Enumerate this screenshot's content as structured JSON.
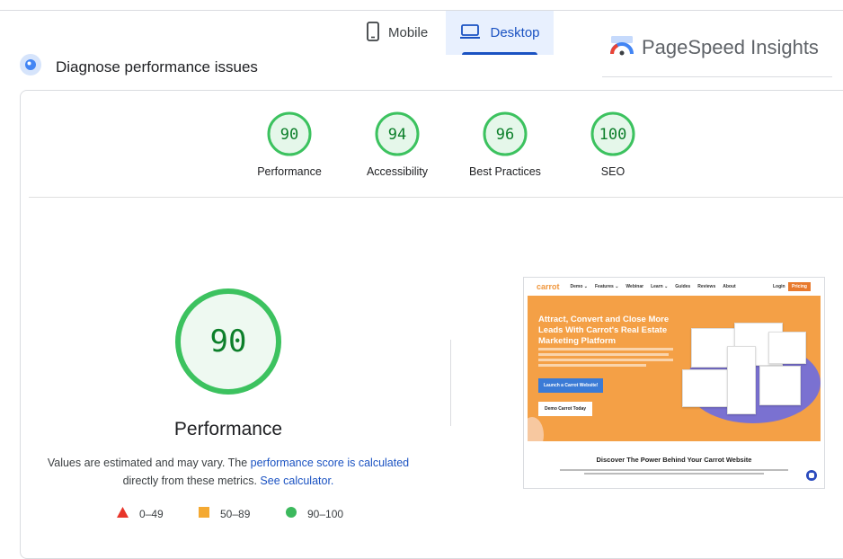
{
  "tabs": {
    "mobile": {
      "label": "Mobile",
      "icon": "mobile-phone-icon"
    },
    "desktop": {
      "label": "Desktop",
      "icon": "laptop-icon",
      "selected": true
    }
  },
  "brand": {
    "name": "PageSpeed Insights",
    "icon": "pagespeed-logo-icon"
  },
  "diagnose": {
    "title": "Diagnose performance issues",
    "icon": "diagnose-icon"
  },
  "scores": [
    {
      "label": "Performance",
      "value": "90"
    },
    {
      "label": "Accessibility",
      "value": "94"
    },
    {
      "label": "Best Practices",
      "value": "96"
    },
    {
      "label": "SEO",
      "value": "100"
    }
  ],
  "main": {
    "score": "90",
    "title": "Performance",
    "desc_prefix": "Values are estimated and may vary. The ",
    "desc_link1": "performance score is calculated",
    "desc_middle": "directly from these metrics. ",
    "desc_link2": "See calculator."
  },
  "legend": [
    {
      "shape": "triangle",
      "color": "#e8352a",
      "range": "0–49"
    },
    {
      "shape": "square",
      "color": "#f4a932",
      "range": "50–89"
    },
    {
      "shape": "circle",
      "color": "#3cb95d",
      "range": "90–100"
    }
  ],
  "colors": {
    "good": "#0c7f2a",
    "good_ring": "#3cc25f",
    "good_bg": "#e5f7ea",
    "accent": "#1a52c2"
  },
  "screenshot": {
    "logo": "carrot",
    "nav": [
      "Demo ⌄",
      "Features ⌄",
      "Webinar",
      "Learn ⌄",
      "Guides",
      "Reviews",
      "About"
    ],
    "login": "Login",
    "pricing": "Pricing",
    "headline": "Attract, Convert and Close More Leads With Carrot's Real Estate Marketing Platform",
    "button_primary": "Launch a Carrot Website!",
    "button_secondary": "Demo Carrot Today",
    "subheading": "Discover The Power Behind Your Carrot Website"
  }
}
